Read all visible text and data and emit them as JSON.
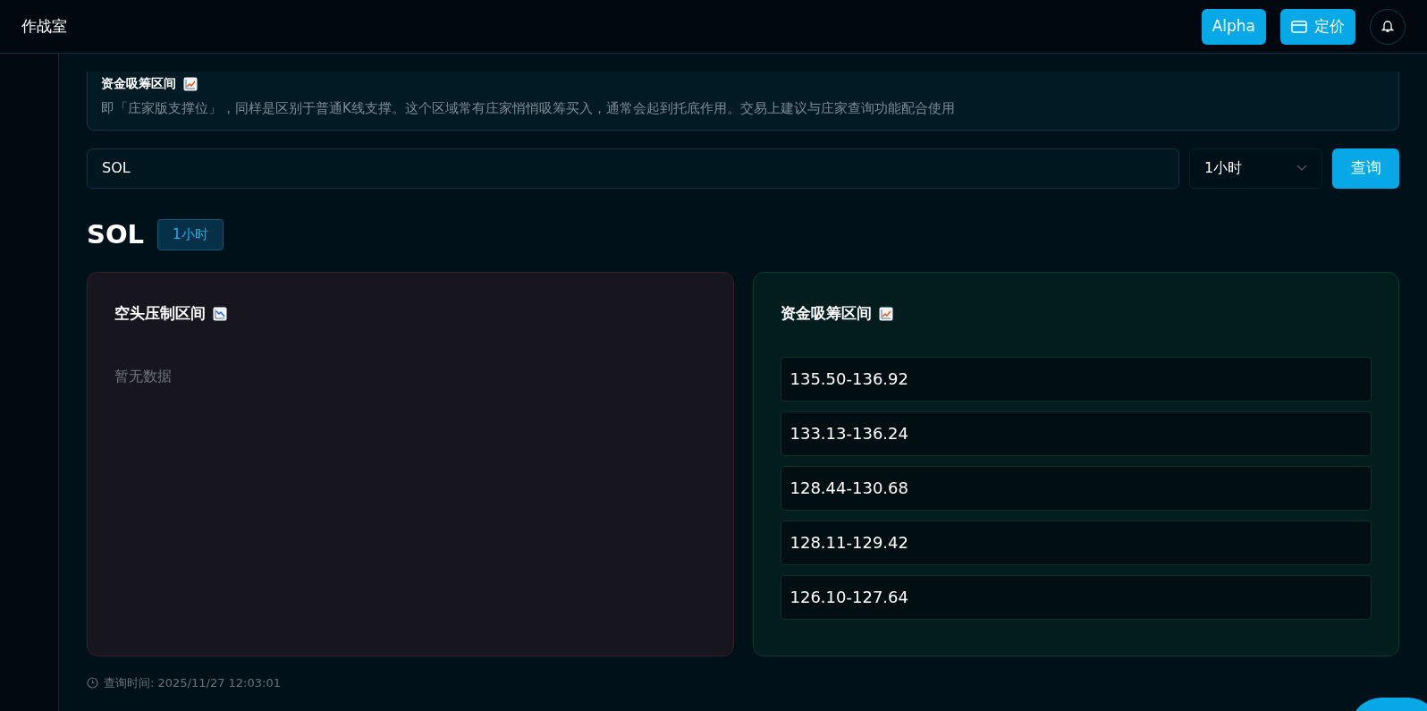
{
  "header": {
    "title": "作战室",
    "alpha_button": "Alpha",
    "pricing_button": "定价"
  },
  "info": {
    "title": "资金吸筹区间",
    "description": "即「庄家版支撑位」，同样是区别于普通K线支撑。这个区域常有庄家悄悄吸筹买入，通常会起到托底作用。交易上建议与庄家查询功能配合使用"
  },
  "query": {
    "value": "SOL",
    "interval": "1小时",
    "button": "查询"
  },
  "result": {
    "symbol": "SOL",
    "interval": "1小时"
  },
  "panels": [
    {
      "kind": "short",
      "title": "空头压制区间",
      "empty": "暂无数据"
    },
    {
      "kind": "long",
      "title": "资金吸筹区间",
      "ranges": [
        "135.50-136.92",
        "133.13-136.24",
        "128.44-130.68",
        "128.11-129.42",
        "126.10-127.64"
      ]
    }
  ],
  "footer": {
    "query_time": "查询时间: 2025/11/27 12:03:01"
  }
}
